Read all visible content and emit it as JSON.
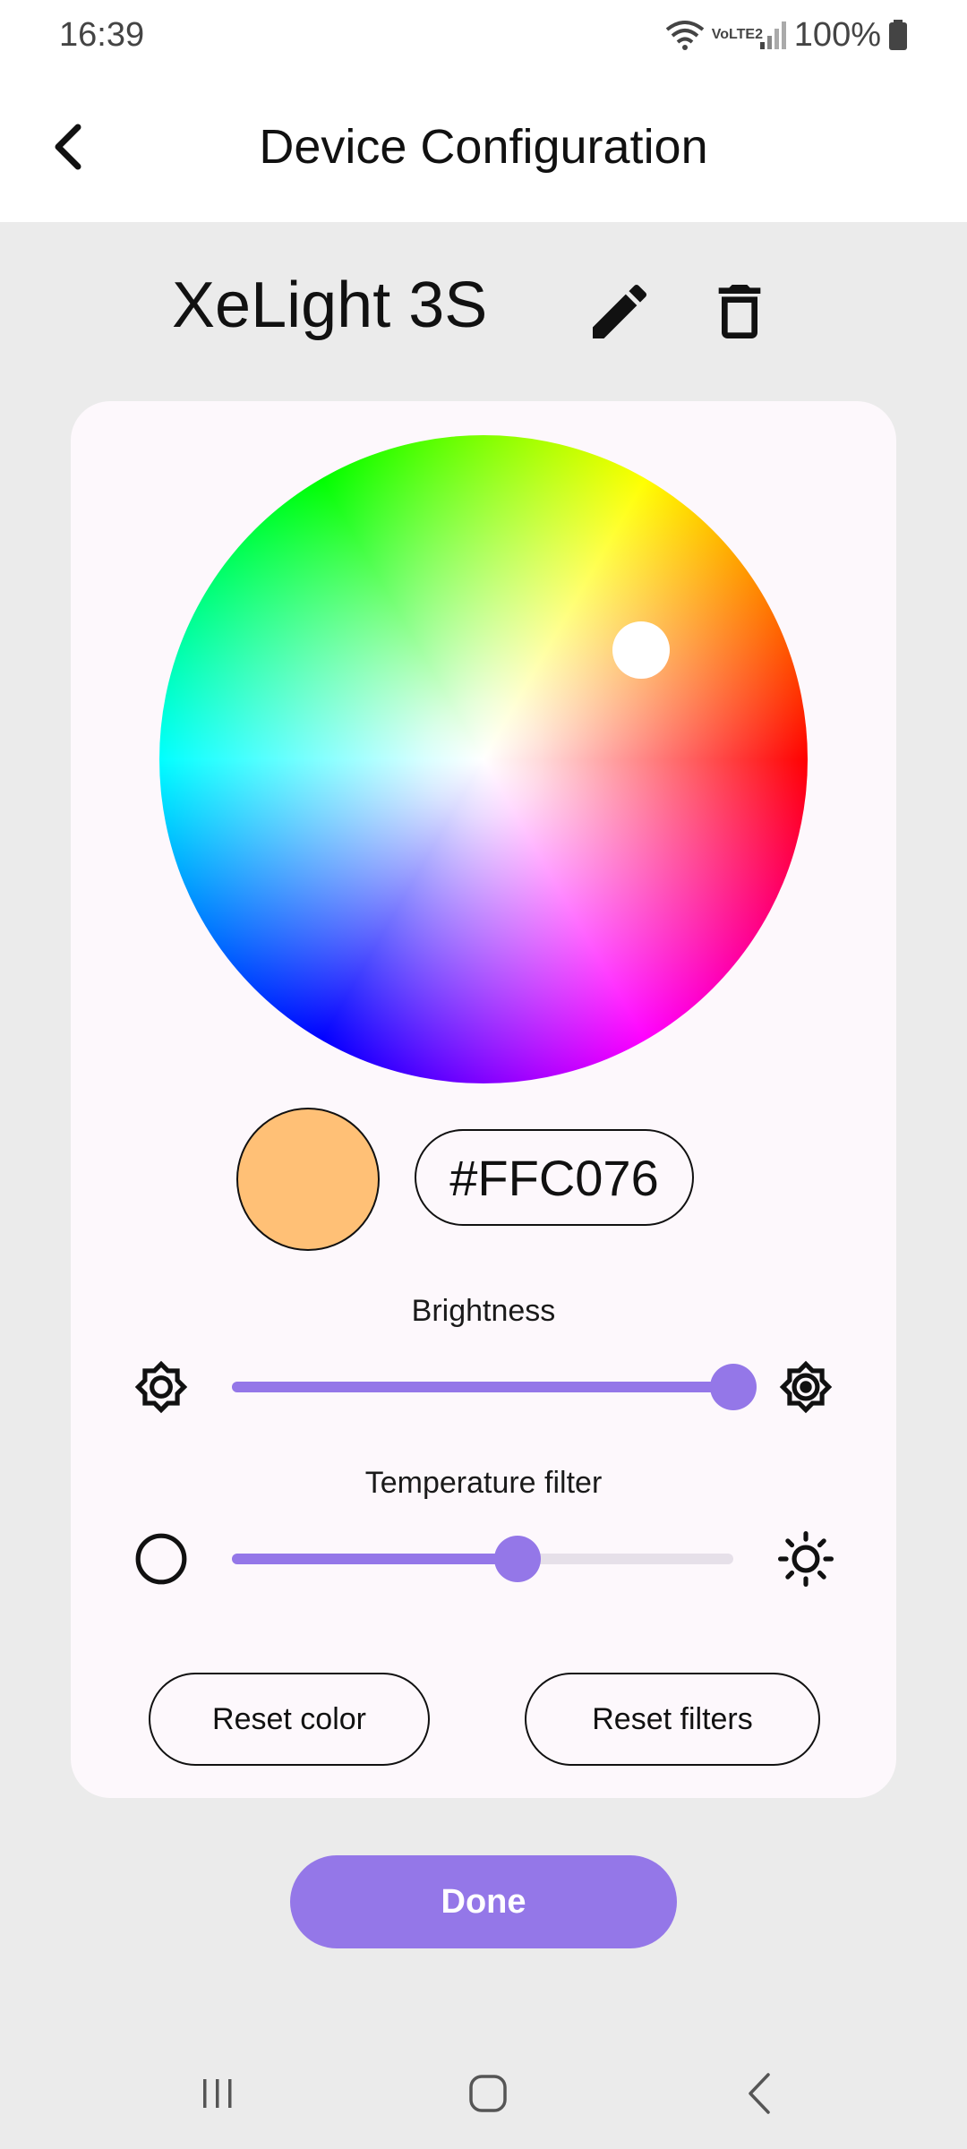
{
  "status_bar": {
    "time": "16:39",
    "network": "VoLTE2",
    "battery": "100%"
  },
  "app_bar": {
    "title": "Device Configuration",
    "back_icon": "chevron-left-icon"
  },
  "device": {
    "name": "XeLight 3S",
    "edit_icon": "pencil-icon",
    "delete_icon": "trash-icon"
  },
  "color": {
    "hex": "#FFC076",
    "swatch_color": "#FFC076"
  },
  "brightness": {
    "label": "Brightness",
    "value": 1.0,
    "min_icon": "brightness-low-icon",
    "max_icon": "brightness-high-icon"
  },
  "temperature": {
    "label": "Temperature filter",
    "value": 0.57,
    "min_icon": "circle-icon",
    "max_icon": "sun-icon"
  },
  "actions": {
    "reset_color": "Reset color",
    "reset_filters": "Reset filters",
    "done": "Done"
  },
  "colors": {
    "accent": "#9477E8",
    "card_bg": "#FDF8FC",
    "page_bg": "#EBEBEB"
  }
}
